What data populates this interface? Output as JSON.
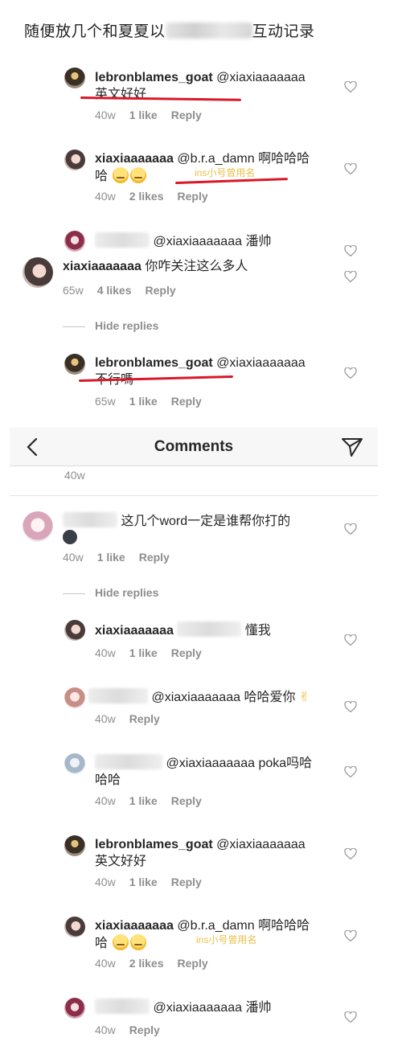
{
  "caption": {
    "prefix": "随便放几个和夏夏以",
    "suffix": "互动记录"
  },
  "section1": {
    "c1": {
      "user": "lebronblames_goat",
      "mention": "@xiaxiaaaaaaa",
      "body": "英文好好",
      "time": "40w",
      "likes": "1 like",
      "reply": "Reply"
    },
    "c2": {
      "user": "xiaxiaaaaaaa",
      "mention": "@b.r.a_damn",
      "body1": "啊哈哈哈",
      "body2": "哈",
      "note": "ins小号曾用名",
      "time": "40w",
      "likes": "2 likes",
      "reply": "Reply"
    },
    "c3": {
      "mention": "@xiaxiaaaaaaa",
      "body": "潘帅"
    },
    "c4": {
      "user": "xiaxiaaaaaaa",
      "body": "你咋关注这么多人",
      "time": "65w",
      "likes": "4 likes",
      "reply": "Reply"
    },
    "hide_replies": "Hide replies",
    "c5": {
      "user": "lebronblames_goat",
      "mention": "@xiaxiaaaaaaa",
      "body": "不行嗎",
      "time": "65w",
      "likes": "1 like",
      "reply": "Reply"
    }
  },
  "navbar": {
    "title": "Comments"
  },
  "section2": {
    "top_time": "40w",
    "c1": {
      "body": "这几个word一定是谁帮你打的",
      "time": "40w",
      "likes": "1 like",
      "reply": "Reply"
    },
    "hide_replies": "Hide replies",
    "c2": {
      "user": "xiaxiaaaaaaa",
      "body": "懂我",
      "time": "40w",
      "likes": "1 like",
      "reply": "Reply"
    },
    "c3": {
      "mention": "@xiaxiaaaaaaa",
      "body": "哈哈爱你",
      "time": "40w",
      "reply": "Reply"
    },
    "c4": {
      "mention": "@xiaxiaaaaaaa",
      "body1": "poka吗哈",
      "body2": "哈哈",
      "time": "40w",
      "likes": "1 like",
      "reply": "Reply"
    },
    "c5": {
      "user": "lebronblames_goat",
      "mention": "@xiaxiaaaaaaa",
      "body": "英文好好",
      "time": "40w",
      "likes": "1 like",
      "reply": "Reply"
    },
    "c6": {
      "user": "xiaxiaaaaaaa",
      "mention": "@b.r.a_damn",
      "body1": "啊哈哈哈",
      "body2": "哈",
      "note": "ins小号曾用名",
      "time": "40w",
      "likes": "2 likes",
      "reply": "Reply"
    },
    "c7": {
      "mention": "@xiaxiaaaaaaa",
      "body": "潘帅",
      "time": "40w",
      "reply": "Reply"
    }
  },
  "colors": {
    "annotation_red": "#d9182a",
    "note_yellow": "#e9bf47",
    "meta_gray": "#8e8e8e"
  },
  "icons": [
    "heart-icon",
    "back-chevron-icon",
    "send-icon",
    "emoji-icon"
  ]
}
